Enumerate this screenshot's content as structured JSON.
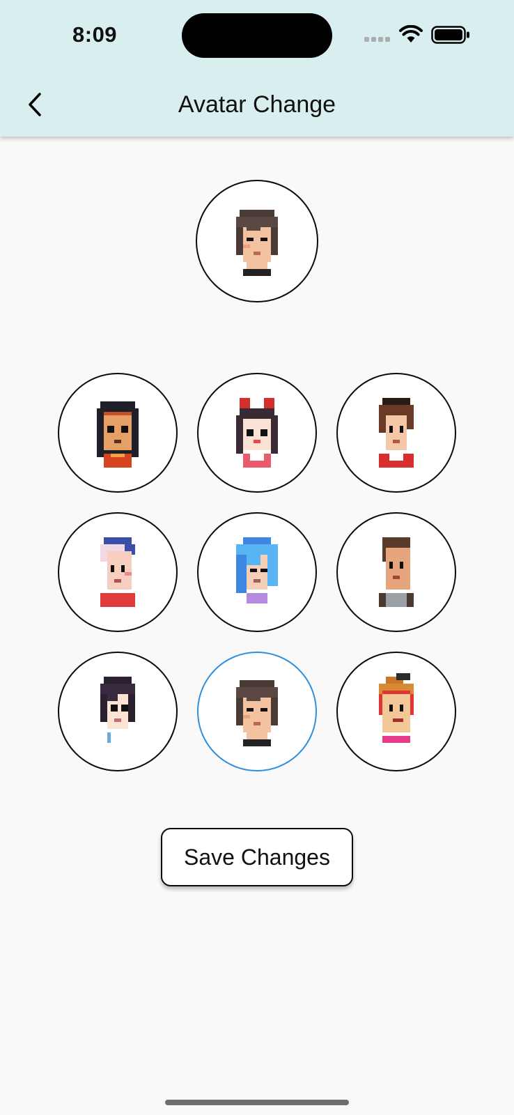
{
  "status_bar": {
    "time": "8:09"
  },
  "header": {
    "back_icon": "chevron-left-icon",
    "title": "Avatar Change"
  },
  "current_avatar": {
    "id": "male-brown-hair"
  },
  "avatar_grid": {
    "avatars": [
      {
        "id": "girl-black-hair-orange-top",
        "selected": false
      },
      {
        "id": "girl-red-bow",
        "selected": false
      },
      {
        "id": "boy-brown-spiky-hair",
        "selected": false
      },
      {
        "id": "boy-white-hair-cap",
        "selected": false
      },
      {
        "id": "girl-blue-hair",
        "selected": false
      },
      {
        "id": "boy-brown-hair-gray-shirt",
        "selected": false
      },
      {
        "id": "boy-dark-hair",
        "selected": false
      },
      {
        "id": "male-brown-hair",
        "selected": true
      },
      {
        "id": "girl-orange-hair-headband",
        "selected": false
      }
    ],
    "selected_border_color": "#2f8fdc"
  },
  "save_button": {
    "label": "Save Changes"
  },
  "colors": {
    "header_bg": "#d9eeef",
    "page_bg": "#f9f9f9"
  }
}
